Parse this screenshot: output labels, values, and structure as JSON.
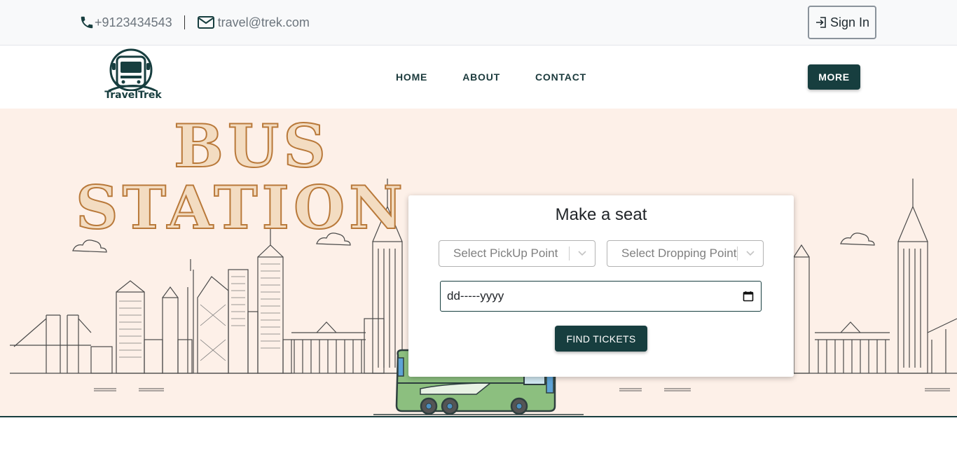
{
  "topbar": {
    "phone": "+9123434543",
    "email": "travel@trek.com",
    "signin_label": "Sign In"
  },
  "brand": {
    "name": "TravelTrek",
    "logo_icon": "bus-icon"
  },
  "nav": {
    "links": [
      "HOME",
      "ABOUT",
      "CONTACT"
    ],
    "more_label": "MORE"
  },
  "hero": {
    "title_line1": "BUS",
    "title_line2": "STATION"
  },
  "booking": {
    "title": "Make a seat",
    "pickup_placeholder": "Select PickUp Point",
    "drop_placeholder": "Select Dropping Point",
    "date_placeholder": "dd-----yyyy",
    "find_label": "FIND TICKETS"
  },
  "colors": {
    "brand_dark": "#173e3f",
    "hero_bg": "#fdf0e8",
    "title_fill": "#f3dcc1",
    "title_stroke": "#b9793a",
    "bus_green": "#8cbf7f"
  }
}
